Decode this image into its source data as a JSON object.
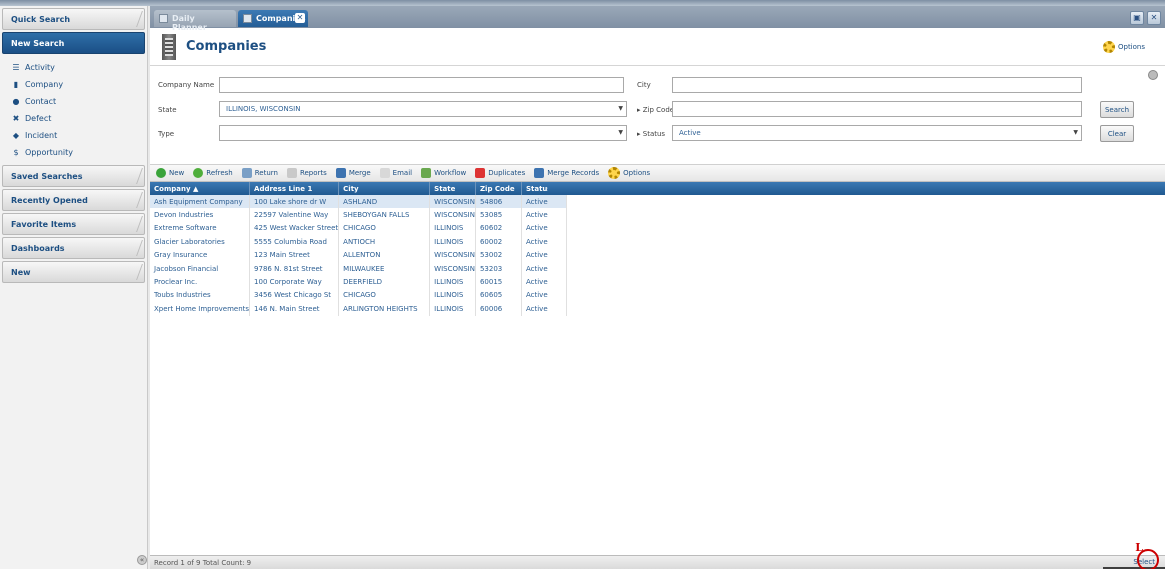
{
  "sidebar": {
    "sections": [
      {
        "label": "Quick Search",
        "active": false
      },
      {
        "label": "New Search",
        "active": true
      }
    ],
    "new_search_items": [
      {
        "label": "Activity",
        "icon": "activity-icon",
        "glyph": "☰"
      },
      {
        "label": "Company",
        "icon": "company-icon",
        "glyph": "▮"
      },
      {
        "label": "Contact",
        "icon": "contact-icon",
        "glyph": "●"
      },
      {
        "label": "Defect",
        "icon": "defect-icon",
        "glyph": "✖"
      },
      {
        "label": "Incident",
        "icon": "incident-icon",
        "glyph": "◆"
      },
      {
        "label": "Opportunity",
        "icon": "opportunity-icon",
        "glyph": "$"
      }
    ],
    "other_sections": [
      "Saved Searches",
      "Recently Opened",
      "Favorite Items",
      "Dashboards",
      "New"
    ]
  },
  "tabs": [
    {
      "label": "Daily Planner",
      "active": false
    },
    {
      "label": "Companies",
      "active": true
    }
  ],
  "header": {
    "title": "Companies",
    "options_label": "Options"
  },
  "form": {
    "company_name_label": "Company Name",
    "company_name_value": "",
    "city_label": "City",
    "city_value": "",
    "state_label": "State",
    "state_value": "ILLINOIS, WISCONSIN",
    "zip_label": "Zip Code",
    "zip_value": "",
    "type_label": "Type",
    "type_value": "",
    "status_label": "Status",
    "status_value": "Active",
    "search_button": "Search",
    "clear_button": "Clear"
  },
  "toolbar": {
    "new": "New",
    "refresh": "Refresh",
    "return": "Return",
    "reports": "Reports",
    "merge": "Merge",
    "email": "Email",
    "workflow": "Workflow",
    "duplicates": "Duplicates",
    "merge_records": "Merge Records",
    "options": "Options"
  },
  "grid": {
    "columns": [
      "Company ▲",
      "Address Line 1",
      "City",
      "State",
      "Zip Code",
      "Status"
    ],
    "rows": [
      [
        "Ash Equipment Company",
        "100 Lake shore dr W",
        "ASHLAND",
        "WISCONSIN",
        "54806",
        "Active"
      ],
      [
        "Devon Industries",
        "22597 Valentine Way",
        "SHEBOYGAN FALLS",
        "WISCONSIN",
        "53085",
        "Active"
      ],
      [
        "Extreme Software",
        "425 West Wacker Street",
        "CHICAGO",
        "ILLINOIS",
        "60602",
        "Active"
      ],
      [
        "Glacier Laboratories",
        "5555 Columbia Road",
        "ANTIOCH",
        "ILLINOIS",
        "60002",
        "Active"
      ],
      [
        "Gray Insurance",
        "123 Main Street",
        "ALLENTON",
        "WISCONSIN",
        "53002",
        "Active"
      ],
      [
        "Jacobson Financial",
        "9786 N. 81st Street",
        "MILWAUKEE",
        "WISCONSIN",
        "53203",
        "Active"
      ],
      [
        "Proclear Inc.",
        "100 Corporate Way",
        "DEERFIELD",
        "ILLINOIS",
        "60015",
        "Active"
      ],
      [
        "Toubs Industries",
        "3456 West Chicago St",
        "CHICAGO",
        "ILLINOIS",
        "60605",
        "Active"
      ],
      [
        "Xpert Home Improvements",
        "146 N. Main Street",
        "ARLINGTON HEIGHTS",
        "ILLINOIS",
        "60006",
        "Active"
      ]
    ]
  },
  "statusbar": {
    "text": "Record 1 of 9   Total Count:   9",
    "select_label": "Select"
  },
  "annotation": {
    "marker": "L"
  }
}
